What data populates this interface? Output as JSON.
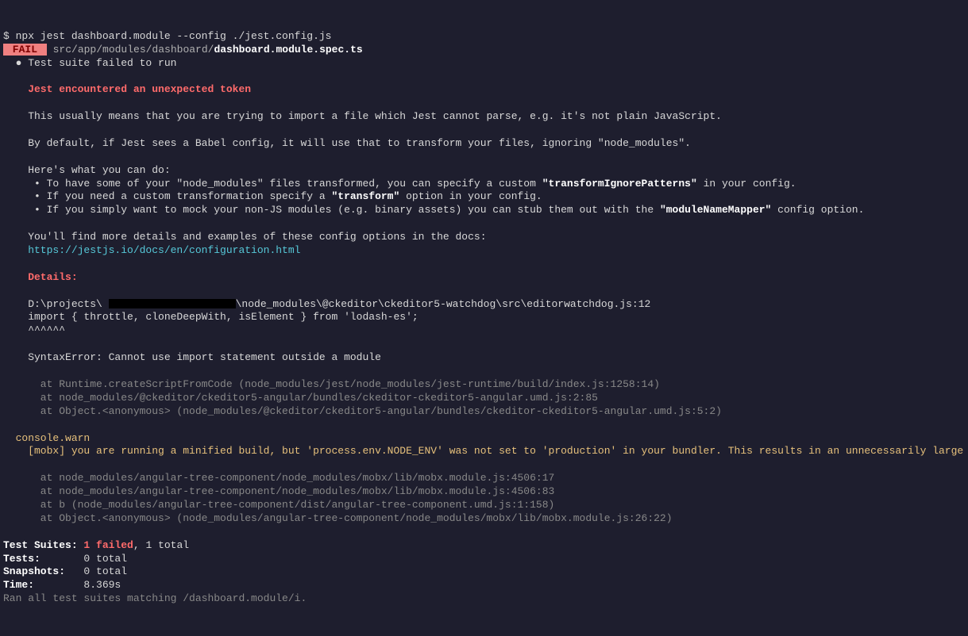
{
  "command": "$ npx jest dashboard.module --config ./jest.config.js",
  "fail_badge": " FAIL ",
  "spec_path_prefix": " src/app/modules/dashboard/",
  "spec_path_bold": "dashboard.module.spec.ts",
  "suite_fail": "  ● Test suite failed to run",
  "err_header": "    Jest encountered an unexpected token",
  "err_desc1": "    This usually means that you are trying to import a file which Jest cannot parse, e.g. it's not plain JavaScript.",
  "err_desc2": "    By default, if Jest sees a Babel config, it will use that to transform your files, ignoring \"node_modules\".",
  "hint_intro": "    Here's what you can do:",
  "hint1_a": "     • To have some of your \"node_modules\" files transformed, you can specify a custom ",
  "hint1_b": "\"transformIgnorePatterns\"",
  "hint1_c": " in your config.",
  "hint2_a": "     • If you need a custom transformation specify a ",
  "hint2_b": "\"transform\"",
  "hint2_c": " option in your config.",
  "hint3_a": "     • If you simply want to mock your non-JS modules (e.g. binary assets) you can stub them out with the ",
  "hint3_b": "\"moduleNameMapper\"",
  "hint3_c": " config option.",
  "docs_intro": "    You'll find more details and examples of these config options in the docs:",
  "docs_link": "    https://jestjs.io/docs/en/configuration.html",
  "details_label": "    Details:",
  "detail_path_a": "    D:\\projects\\ ",
  "detail_path_b": "\\node_modules\\@ckeditor\\ckeditor5-watchdog\\src\\editorwatchdog.js:12",
  "detail_import": "    import { throttle, cloneDeepWith, isElement } from 'lodash-es';",
  "detail_caret": "    ^^^^^^",
  "syntax_err": "    SyntaxError: Cannot use import statement outside a module",
  "stack1": "      at Runtime.createScriptFromCode (node_modules/jest/node_modules/jest-runtime/build/index.js:1258:14)",
  "stack2": "      at node_modules/@ckeditor/ckeditor5-angular/bundles/ckeditor-ckeditor5-angular.umd.js:2:85",
  "stack3": "      at Object.<anonymous> (node_modules/@ckeditor/ckeditor5-angular/bundles/ckeditor-ckeditor5-angular.umd.js:5:2)",
  "console_warn": "  console.warn",
  "mobx_warn": "    [mobx] you are running a minified build, but 'process.env.NODE_ENV' was not set to 'production' in your bundler. This results in an unnecessarily large and slow bundle",
  "warn_stack1": "      at node_modules/angular-tree-component/node_modules/mobx/lib/mobx.module.js:4506:17",
  "warn_stack2": "      at node_modules/angular-tree-component/node_modules/mobx/lib/mobx.module.js:4506:83",
  "warn_stack3": "      at b (node_modules/angular-tree-component/dist/angular-tree-component.umd.js:1:158)",
  "warn_stack4": "      at Object.<anonymous> (node_modules/angular-tree-component/node_modules/mobx/lib/mobx.module.js:26:22)",
  "summary": {
    "suites_label": "Test Suites: ",
    "suites_fail": "1 failed",
    "suites_rest": ", 1 total",
    "tests_label": "Tests:       ",
    "tests_val": "0 total",
    "snaps_label": "Snapshots:   ",
    "snaps_val": "0 total",
    "time_label": "Time:        ",
    "time_val": "8.369s",
    "ran": "Ran all test suites matching /dashboard.module/i."
  }
}
